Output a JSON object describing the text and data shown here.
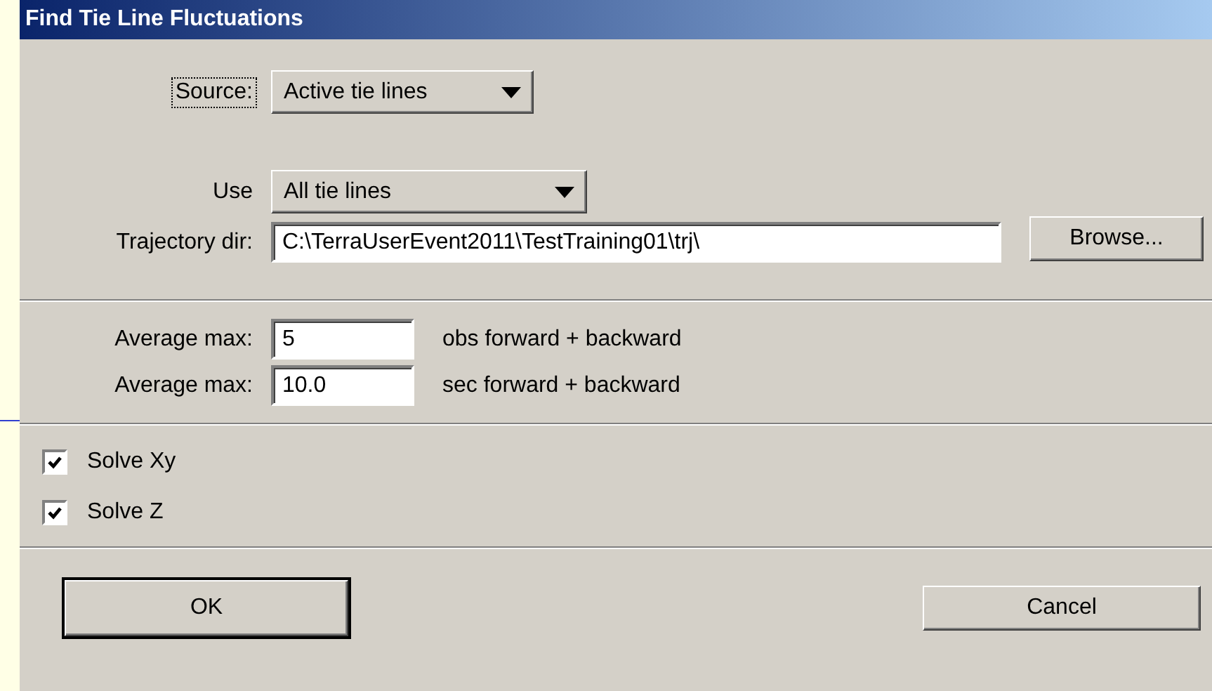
{
  "window": {
    "title": "Find Tie Line Fluctuations"
  },
  "source": {
    "label": "Source:",
    "value": "Active tie lines",
    "focused": true
  },
  "use": {
    "label": "Use",
    "value": "All tie lines"
  },
  "trajectory_dir": {
    "label": "Trajectory dir:",
    "value": "C:\\TerraUserEvent2011\\TestTraining01\\trj\\",
    "browse_button": "Browse..."
  },
  "averages": [
    {
      "label": "Average max:",
      "value": "5",
      "unit": "obs forward + backward"
    },
    {
      "label": "Average max:",
      "value": "10.0",
      "unit": "sec forward + backward"
    }
  ],
  "checkboxes": [
    {
      "label": "Solve Xy",
      "checked": true
    },
    {
      "label": "Solve Z",
      "checked": true
    }
  ],
  "buttons": [
    {
      "label": "OK",
      "default": true
    },
    {
      "label": "Cancel",
      "default": false
    }
  ]
}
